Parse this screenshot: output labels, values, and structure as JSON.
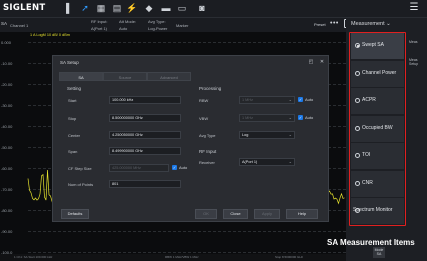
{
  "topbar": {
    "logo": "SIGLENT"
  },
  "chanbar": {
    "mode": "SA",
    "channel": "Channel 1",
    "trace": [
      "1",
      "M",
      "W"
    ],
    "rf_input_label": "RF Input:",
    "rf_input_value": "A(Port 1)",
    "att_mode_label": "Att Mode:",
    "att_mode_value": "Auto",
    "avg_type_label": "Avg Type:",
    "avg_type_value": "Log-Power",
    "marker_label": "Marker",
    "preset": "Preset"
  },
  "plot": {
    "ref_label": "1 A  LogM  10 dB/  0 dBm",
    "y_labels": [
      "0.000",
      "-10.00",
      "-20.00",
      "-30.00",
      "-40.00",
      "-50.00",
      "-60.00",
      "-70.00",
      "-80.00",
      "-90.00",
      "-100.0"
    ],
    "bottom": {
      "left": "1  Ch1: SA Start 100.000 kHz",
      "center": "RBW 1 MHz/VBW 1 MHz",
      "right": "Stop 8.5000000 GHz"
    }
  },
  "dialog": {
    "title": "SA Setup",
    "tabs": [
      "SA",
      "Source",
      "Advanced"
    ],
    "setting_title": "Setting",
    "processing_title": "Processing",
    "rf_input_title": "RF Input",
    "fields": {
      "start_label": "Start",
      "start_value": "100.000 kHz",
      "stop_label": "Stop",
      "stop_value": "8.500000000 GHz",
      "center_label": "Center",
      "center_value": "4.250050000 GHz",
      "span_label": "Span",
      "span_value": "8.499900000 GHz",
      "cf_step_label": "CF Step Size",
      "cf_step_value": "425.000000 MHz",
      "points_label": "Num of Points",
      "points_value": "801",
      "rbw_label": "RBW",
      "rbw_value": "1 MHz",
      "vbw_label": "VBW",
      "vbw_value": "1 MHz",
      "avg_type_label": "Avg Type",
      "avg_type_value": "Log",
      "receiver_label": "Receiver",
      "receiver_value": "A(Port 1)",
      "auto": "Auto"
    },
    "buttons": {
      "defaults": "Defaults",
      "ok": "OK",
      "close": "Close",
      "apply": "Apply",
      "help": "Help"
    }
  },
  "side": {
    "title": "Measurement",
    "mode_label": "Meas",
    "setup_label": "Meas Setup",
    "items": [
      {
        "label": "Swept SA",
        "selected": true
      },
      {
        "label": "Channel Power",
        "selected": false
      },
      {
        "label": "ACPR",
        "selected": false
      },
      {
        "label": "Occupied BW",
        "selected": false
      },
      {
        "label": "TOI",
        "selected": false
      },
      {
        "label": "CNR",
        "selected": false
      },
      {
        "label": "Spectrum Monitor",
        "selected": false
      }
    ],
    "mode_button_top": "Mode",
    "mode_button_bottom": "SA"
  },
  "caption": "SA Measurement Items",
  "colors": {
    "trace": "#e6e22e",
    "highlight_border": "#e02020",
    "checkbox": "#1b78e6",
    "background": "#141518"
  }
}
